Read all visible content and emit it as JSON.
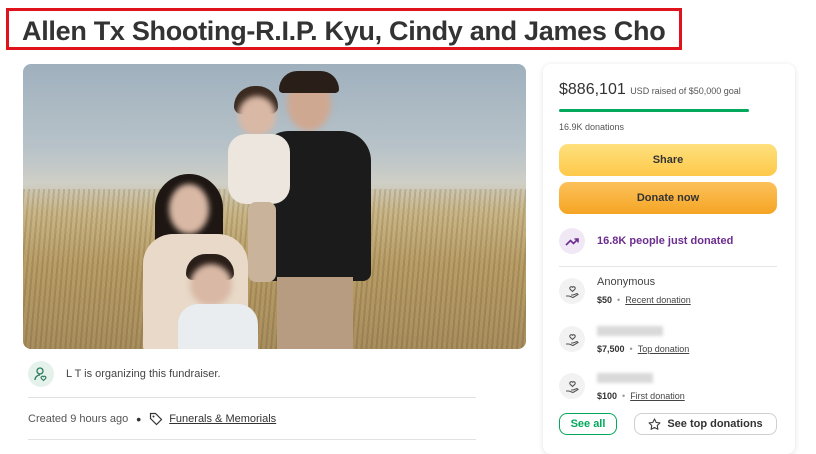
{
  "campaign": {
    "title": "Allen Tx Shooting-R.I.P. Kyu, Cindy and James Cho"
  },
  "organizer": {
    "text": "L T is organizing this fundraiser.",
    "icon": "person-heart-icon"
  },
  "meta": {
    "created": "Created 9 hours ago",
    "category": "Funerals & Memorials"
  },
  "donation_panel": {
    "raised": "$886,101",
    "goal_text": "USD raised of $50,000 goal",
    "progress_fraction": 1.0,
    "donation_count": "16.9K donations",
    "share_label": "Share",
    "donate_label": "Donate now",
    "trend_text": "16.8K people just donated",
    "donors": [
      {
        "name": "Anonymous",
        "amount": "$50",
        "kind": "Recent donation"
      },
      {
        "name": "",
        "amount": "$7,500",
        "kind": "Top donation"
      },
      {
        "name": "",
        "amount": "$100",
        "kind": "First donation"
      }
    ],
    "see_all_label": "See all",
    "see_top_label": "See top donations",
    "colors": {
      "accent": "#02a95c",
      "share": "#fdd15c",
      "donate": "#f8b133",
      "trend": "#6c2d8f"
    }
  }
}
